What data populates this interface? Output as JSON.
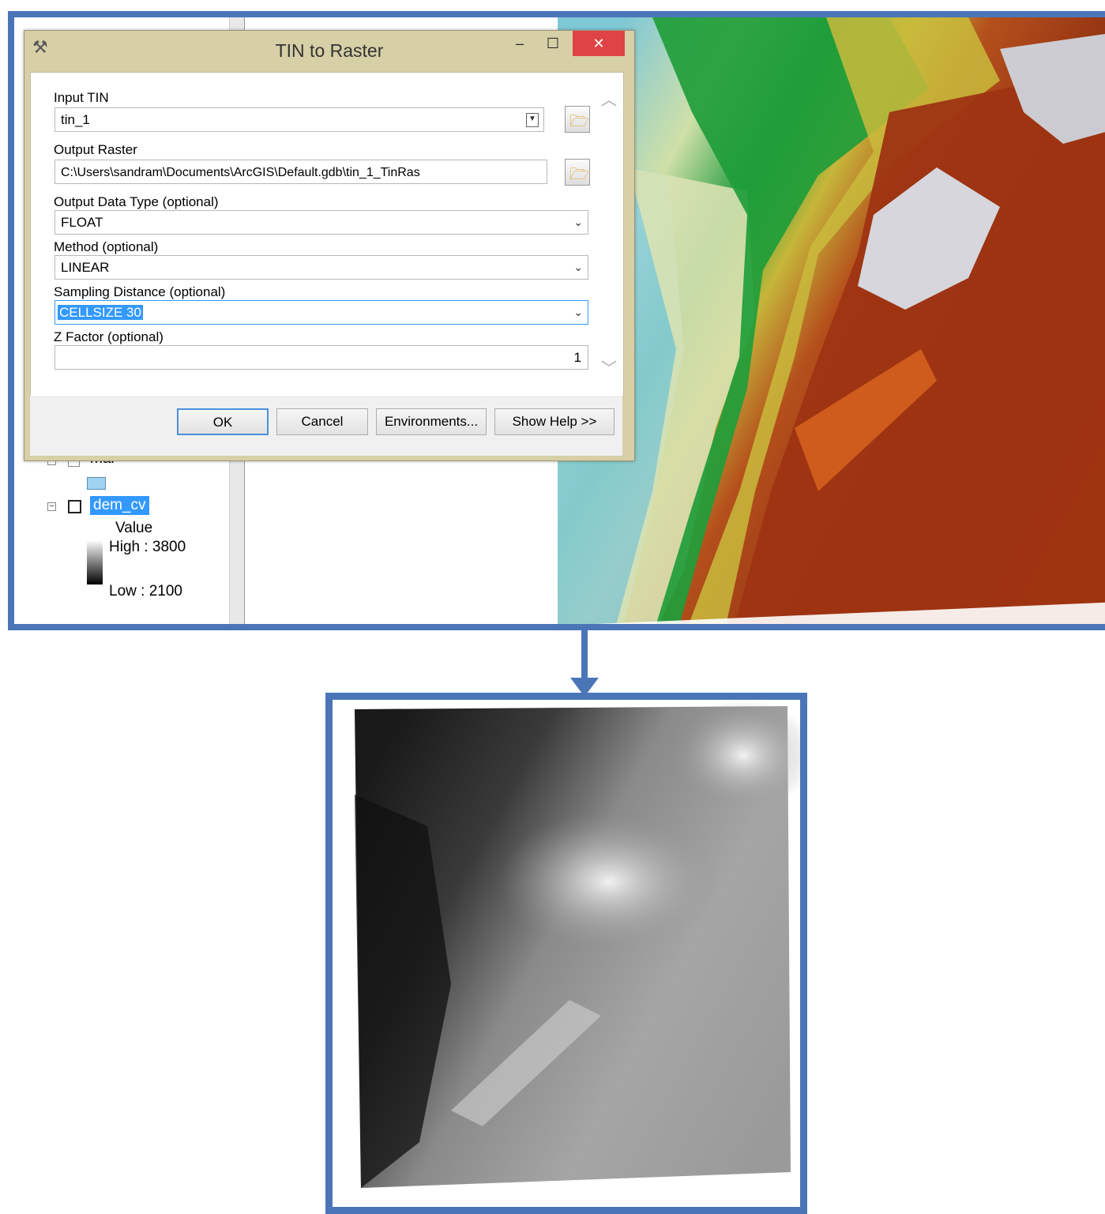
{
  "dialog": {
    "title": "TIN to Raster",
    "fields": {
      "input_tin": {
        "label": "Input TIN",
        "value": "tin_1"
      },
      "output_raster": {
        "label": "Output Raster",
        "value": "C:\\Users\\sandram\\Documents\\ArcGIS\\Default.gdb\\tin_1_TinRas"
      },
      "data_type": {
        "label": "Output Data Type (optional)",
        "value": "FLOAT"
      },
      "method": {
        "label": "Method (optional)",
        "value": "LINEAR"
      },
      "sampling": {
        "label": "Sampling Distance (optional)",
        "value": "CELLSIZE 30"
      },
      "z_factor": {
        "label": "Z Factor (optional)",
        "value": "1"
      }
    },
    "buttons": {
      "ok": "OK",
      "cancel": "Cancel",
      "environments": "Environments...",
      "show_help": "Show Help >>"
    }
  },
  "toc": {
    "layer_partial": "mar",
    "layer_dem": "dem_cv",
    "legend_title": "Value",
    "legend_high": "High : 3800",
    "legend_low": "Low : 2100"
  },
  "colors": {
    "frame": "#4a76b8",
    "selection": "#3399ff",
    "dialog_chrome": "#d7cfa6",
    "close_button": "#e04343"
  }
}
